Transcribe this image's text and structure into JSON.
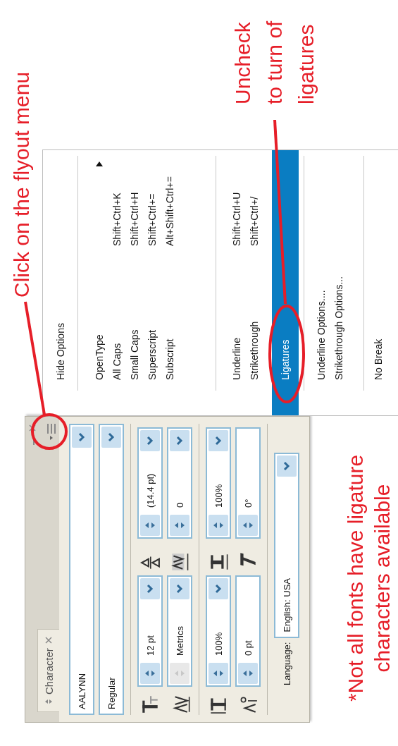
{
  "annotations": [
    {
      "kind": "callout",
      "lines": [
        "Click on the flyout menu"
      ]
    },
    {
      "kind": "callout",
      "lines": [
        "Uncheck",
        "to turn of",
        "ligatures"
      ]
    },
    {
      "kind": "footnote",
      "lines": [
        "*Not all fonts have ligature",
        "characters available"
      ]
    }
  ],
  "panel": {
    "tab": {
      "label": "Character",
      "selected": true
    },
    "font_family": "AALYNN",
    "font_style": "Regular",
    "field_groups": [
      [
        [
          {
            "kind": "font-size",
            "value": "12 pt",
            "spinner_disabled": false,
            "dropdown": true
          },
          {
            "kind": "leading",
            "value": "(14.4 pt)",
            "spinner_disabled": false,
            "dropdown": true
          }
        ],
        [
          {
            "kind": "kerning",
            "value": "Metrics",
            "spinner_disabled": true,
            "dropdown": true
          },
          {
            "kind": "tracking",
            "value": "0",
            "spinner_disabled": false,
            "dropdown": true
          }
        ]
      ],
      [
        [
          {
            "kind": "vertical-scale",
            "value": "100%",
            "spinner_disabled": false,
            "dropdown": true
          },
          {
            "kind": "horizontal-scale",
            "value": "100%",
            "spinner_disabled": false,
            "dropdown": true
          }
        ],
        [
          {
            "kind": "baseline-shift",
            "value": "0 pt",
            "spinner_disabled": false,
            "dropdown": false
          },
          {
            "kind": "skew",
            "value": "0°",
            "spinner_disabled": false,
            "dropdown": false
          }
        ]
      ]
    ],
    "language_label": "Language:",
    "language": "English: USA"
  },
  "menu": {
    "sections": [
      [
        {
          "label": "Hide Options",
          "selected": false
        }
      ],
      [
        {
          "label": "OpenType",
          "submenu": true,
          "selected": false
        },
        {
          "label": "All Caps",
          "shortcut": "Shift+Ctrl+K",
          "selected": false
        },
        {
          "label": "Small Caps",
          "shortcut": "Shift+Ctrl+H",
          "selected": false
        },
        {
          "label": "Superscript",
          "shortcut": "Shift+Ctrl+=",
          "selected": false
        },
        {
          "label": "Subscript",
          "shortcut": "Alt+Shift+Ctrl+=",
          "selected": false
        }
      ],
      [
        {
          "label": "Underline",
          "shortcut": "Shift+Ctrl+U",
          "selected": false
        },
        {
          "label": "Strikethrough",
          "shortcut": "Shift+Ctrl+/",
          "selected": false
        },
        {
          "label": "Ligatures",
          "selected": true
        }
      ],
      [
        {
          "label": "Underline Options....",
          "selected": false
        },
        {
          "label": "Strikethrough Options...",
          "selected": false
        }
      ],
      [
        {
          "label": "No Break",
          "selected": false
        }
      ]
    ]
  }
}
